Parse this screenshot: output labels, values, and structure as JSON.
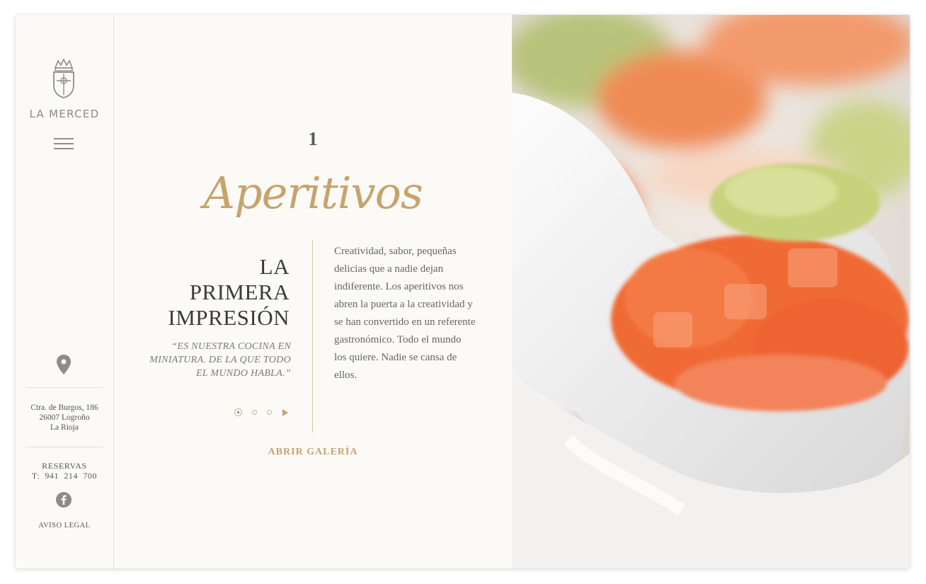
{
  "brand": {
    "name": "LA MERCED"
  },
  "menu": {
    "icon": "hamburger-menu-icon"
  },
  "location": {
    "icon": "map-pin-icon",
    "address": [
      "Ctra. de Burgos, 186",
      "26007 Logroño",
      "La Rioja"
    ]
  },
  "contact": {
    "reservas_label": "RESERVAS",
    "phone": "T:  941  214  700",
    "social_icon": "facebook-icon",
    "legal": "AVISO LEGAL"
  },
  "section": {
    "number": "1",
    "script_title": "Aperitivos",
    "heading": [
      "LA",
      "PRIMERA",
      "IMPRESIÓN"
    ],
    "quote": "“ES NUESTRA COCINA EN MINIATURA. DE LA QUE TODO EL MUNDO HABLA.”",
    "description": "Creatividad, sabor, pequeñas delicias que a nadie dejan indiferente. Los aperitivos nos abren la puerta a la creatividad y se han convertido en un referente gastronómico. Todo el mundo los quiere. Nadie se cansa de ellos.",
    "gallery_link": "ABRIR GALERÍA",
    "slides": {
      "count": 3,
      "active": 1
    }
  },
  "colors": {
    "accent": "#c6a46d",
    "text_dark": "#3b3b3b",
    "text_muted": "#666666",
    "background": "#fbfaf7"
  }
}
